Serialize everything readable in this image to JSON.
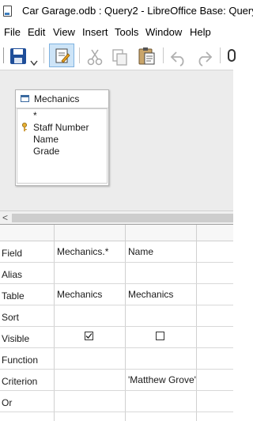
{
  "window": {
    "title": "Car Garage.odb : Query2 - LibreOffice Base: Query"
  },
  "menu": [
    "File",
    "Edit",
    "View",
    "Insert",
    "Tools",
    "Window",
    "Help"
  ],
  "toolbar": {
    "icons": [
      "save-icon",
      "dropdown-arrow-icon",
      "edit-mode-icon",
      "cut-icon",
      "copy-icon",
      "paste-icon",
      "undo-icon",
      "redo-icon"
    ]
  },
  "table_window": {
    "title": "Mechanics",
    "fields": [
      {
        "name": "*",
        "key": false
      },
      {
        "name": "Staff Number",
        "key": true
      },
      {
        "name": "Name",
        "key": false
      },
      {
        "name": "Grade",
        "key": false
      }
    ]
  },
  "grid": {
    "row_labels": [
      "Field",
      "Alias",
      "Table",
      "Sort",
      "Visible",
      "Function",
      "Criterion",
      "Or"
    ],
    "columns": [
      {
        "field": "Mechanics.*",
        "alias": "",
        "table": "Mechanics",
        "sort": "",
        "visible": true,
        "function": "",
        "criterion": "",
        "or": ""
      },
      {
        "field": "Name",
        "alias": "",
        "table": "Mechanics",
        "sort": "",
        "visible": false,
        "function": "",
        "criterion": "'Matthew Grove'",
        "or": ""
      }
    ]
  }
}
